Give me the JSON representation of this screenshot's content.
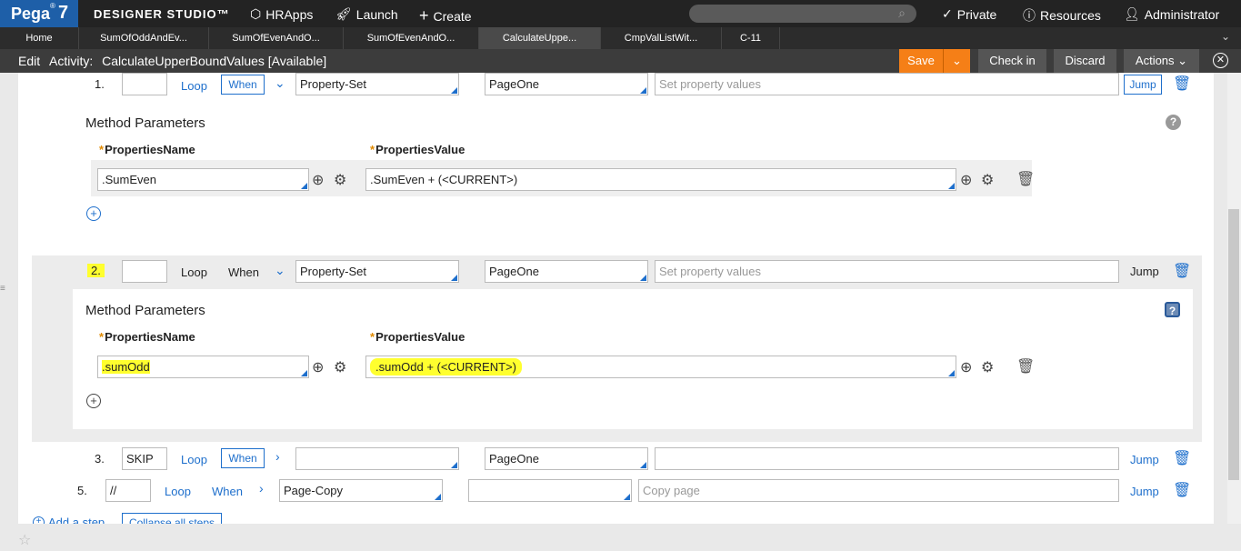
{
  "topbar": {
    "logo_text": "Pega",
    "logo_sup": "®",
    "logo_version": "7",
    "brand": "DESIGNER STUDIO™",
    "app": "HRApps",
    "launch": "Launch",
    "create": "Create",
    "private": "Private",
    "resources": "Resources",
    "user": "Administrator"
  },
  "tabs": [
    {
      "label": "Home"
    },
    {
      "label": "SumOfOddAndEv..."
    },
    {
      "label": "SumOfEvenAndO..."
    },
    {
      "label": "SumOfEvenAndO..."
    },
    {
      "label": "CalculateUppe..."
    },
    {
      "label": "CmpValListWit..."
    },
    {
      "label": "C-11"
    }
  ],
  "header": {
    "edit": "Edit",
    "type": "Activity:",
    "name": "CalculateUpperBoundValues [Available]",
    "save": "Save",
    "checkin": "Check in",
    "discard": "Discard",
    "actions": "Actions"
  },
  "steps": {
    "s1": {
      "num": "1.",
      "label": "",
      "loop": "Loop",
      "when": "When",
      "method": "Property-Set",
      "page": "PageOne",
      "description_placeholder": "Set property values",
      "jump": "Jump"
    },
    "s2": {
      "num": "2.",
      "label": "",
      "loop": "Loop",
      "when": "When",
      "method": "Property-Set",
      "page": "PageOne",
      "description_placeholder": "Set property values",
      "jump": "Jump"
    },
    "s3": {
      "num": "3.",
      "label": "SKIP",
      "loop": "Loop",
      "when": "When",
      "method": "",
      "page": "PageOne",
      "description": "",
      "jump": "Jump"
    },
    "s5": {
      "num": "5.",
      "label": "//",
      "loop": "Loop",
      "when": "When",
      "method": "Page-Copy",
      "page": "",
      "description_placeholder": "Copy page",
      "jump": "Jump"
    }
  },
  "params1": {
    "title": "Method Parameters",
    "col_name": "PropertiesName",
    "col_value": "PropertiesValue",
    "name": ".SumEven",
    "value": ".SumEven + (<CURRENT>)"
  },
  "params2": {
    "title": "Method Parameters",
    "col_name": "PropertiesName",
    "col_value": "PropertiesValue",
    "name": ".sumOdd",
    "value": ".sumOdd + (<CURRENT>)"
  },
  "footer": {
    "add_step": "Add a step",
    "collapse_all": "Collapse all steps"
  },
  "colors": {
    "accent": "#1e6fcc",
    "save_orange": "#f57f17",
    "highlight": "#ffff2e"
  }
}
